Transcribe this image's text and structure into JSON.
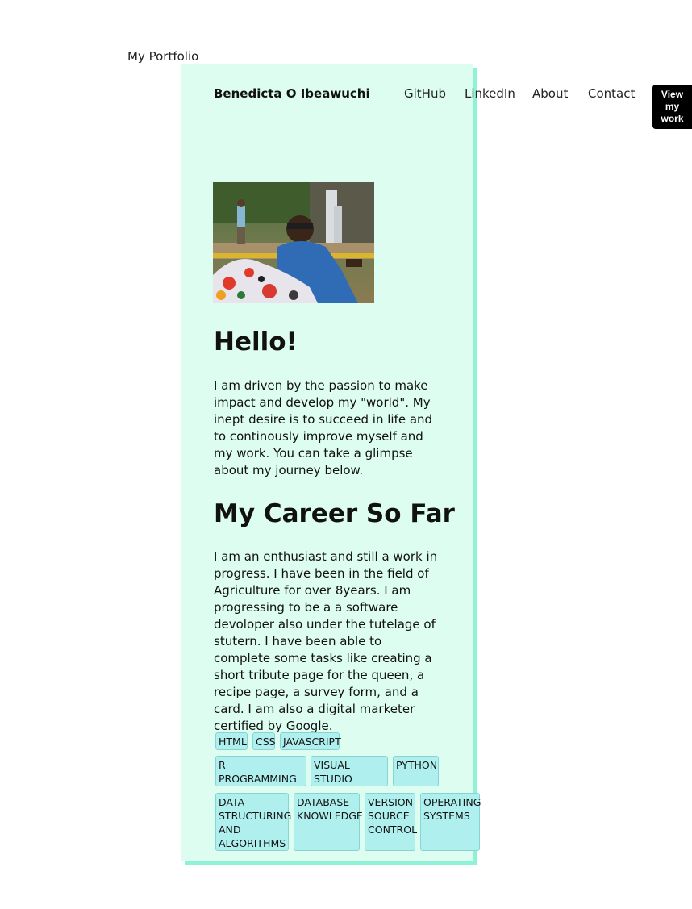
{
  "page": {
    "title": "My Portfolio"
  },
  "header": {
    "brand": "Benedicta O Ibeawuchi",
    "nav": [
      "GitHub",
      "LinkedIn",
      "About",
      "Contact"
    ],
    "cta": "View my work"
  },
  "hero": {
    "photo_alt": "Profile photo of Benedicta seated outdoors in front of a waterfall",
    "heading": "Hello!",
    "intro": "I am driven by the passion to make impact and develop my \"world\". My inept desire is to succeed in life and to continously improve myself and my work. You can take a glimpse about my journey below."
  },
  "career": {
    "heading": "My Career So Far",
    "text": "I am an enthusiast and still a work in progress. I have been in the field of Agriculture for over 8years. I am progressing to be a a software devoloper also under the tutelage of stutern. I have been able to complete some tasks like creating a short tribute page for the queen, a recipe page, a survey form, and a card. I am also a digital marketer certified by Google."
  },
  "skills": [
    "HTML",
    "CSS",
    "JAVASCRIPT",
    "R PROGRAMMING",
    "VISUAL STUDIO",
    "PYTHON",
    "DATA STRUCTURING AND ALGORITHMS",
    "DATABASE KNOWLEDGE",
    "VERSION SOURCE CONTROL",
    "OPERATING SYSTEMS"
  ],
  "colors": {
    "card_bg": "#dcfdef",
    "card_shadow": "#8ef3d6",
    "tag_bg": "#aff0ef",
    "cta_bg": "#000000"
  }
}
